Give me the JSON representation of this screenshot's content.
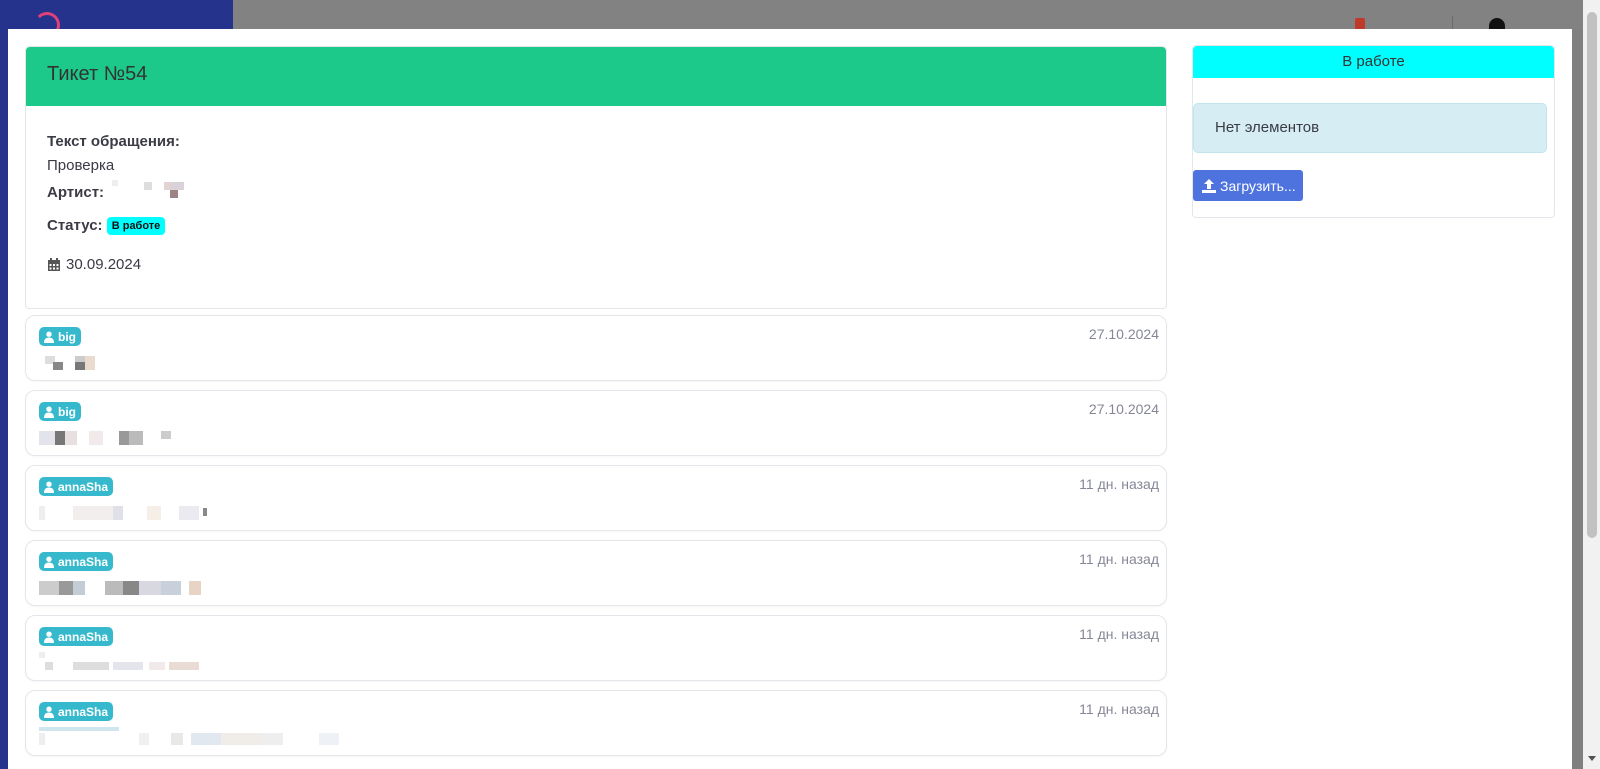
{
  "ticket": {
    "title": "Тикет №54",
    "text_label": "Текст обращения:",
    "text_value": "Проверка",
    "artist_label": "Артист:",
    "status_label": "Статус:",
    "status_badge": "В работе",
    "date": "30.09.2024",
    "icons": {
      "calendar": "calendar-icon"
    }
  },
  "messages": [
    {
      "author": "big",
      "date": "27.10.2024"
    },
    {
      "author": "big",
      "date": "27.10.2024"
    },
    {
      "author": "annaSha",
      "date": "11 дн. назад"
    },
    {
      "author": "annaSha",
      "date": "11 дн. назад"
    },
    {
      "author": "annaSha",
      "date": "11 дн. назад"
    },
    {
      "author": "annaSha",
      "date": "11 дн. назад"
    }
  ],
  "side": {
    "status_header": "В работе",
    "empty_text": "Нет элементов",
    "upload_label": "Загрузить..."
  },
  "colors": {
    "header_green": "#1cc88a",
    "status_cyan": "#00ffff",
    "user_badge": "#36b9cc",
    "upload_button": "#4e73df",
    "sidebar_blue": "#25338c"
  }
}
